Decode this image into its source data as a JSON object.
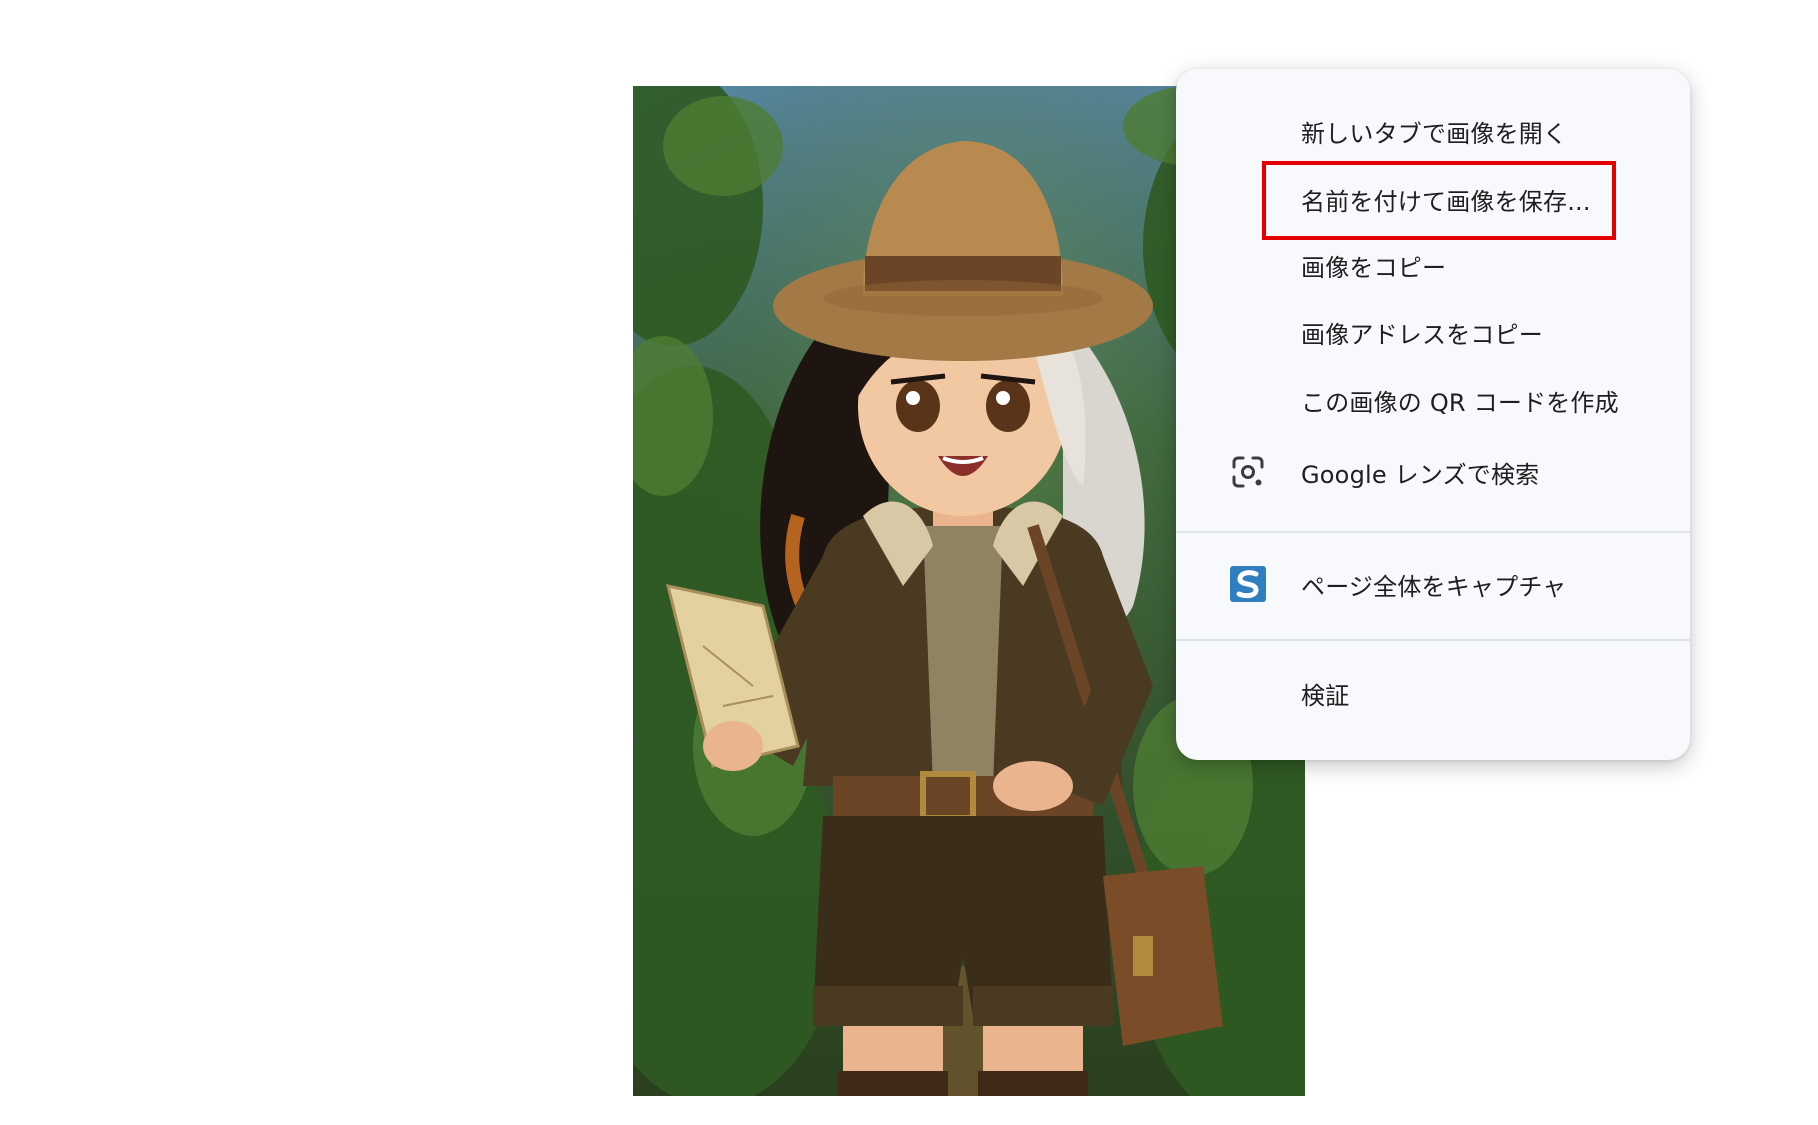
{
  "context_menu": {
    "items": [
      {
        "label": "新しいタブで画像を開く"
      },
      {
        "label": "名前を付けて画像を保存..."
      },
      {
        "label": "画像をコピー"
      },
      {
        "label": "画像アドレスをコピー"
      },
      {
        "label": "この画像の QR コードを作成"
      },
      {
        "label": "Google レンズで検索",
        "icon": "google-lens-icon"
      },
      {
        "label": "ページ全体をキャプチャ",
        "icon": "capture-extension-icon"
      },
      {
        "label": "検証"
      }
    ],
    "highlighted_item": "名前を付けて画像を保存..."
  },
  "colors": {
    "menu_background": "#f8f9fc",
    "highlight_border": "#e50000",
    "text": "#1f1f1f"
  }
}
